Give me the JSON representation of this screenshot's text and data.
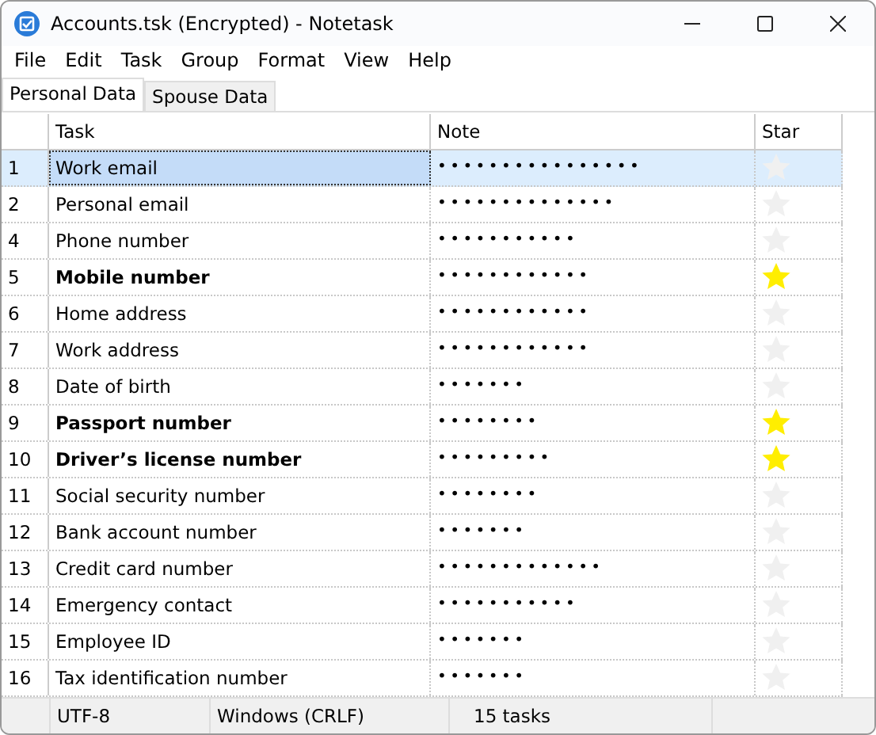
{
  "window": {
    "title": "Accounts.tsk (Encrypted) - Notetask"
  },
  "menu": [
    "File",
    "Edit",
    "Task",
    "Group",
    "Format",
    "View",
    "Help"
  ],
  "tabs": [
    {
      "label": "Personal Data",
      "selected": true
    },
    {
      "label": "Spouse Data",
      "selected": false
    }
  ],
  "table": {
    "columns": [
      "Task",
      "Note",
      "Star"
    ],
    "rows": [
      {
        "number": "1",
        "task": "Work email",
        "note": "••••••••••••••••",
        "starred": false,
        "selected": true
      },
      {
        "number": "2",
        "task": "Personal email",
        "note": "••••••••••••••",
        "starred": false,
        "selected": false
      },
      {
        "number": "4",
        "task": "Phone number",
        "note": "•••••••••••",
        "starred": false,
        "selected": false
      },
      {
        "number": "5",
        "task": "Mobile number",
        "note": "••••••••••••",
        "starred": true,
        "selected": false
      },
      {
        "number": "6",
        "task": "Home address",
        "note": "••••••••••••",
        "starred": false,
        "selected": false
      },
      {
        "number": "7",
        "task": "Work address",
        "note": "••••••••••••",
        "starred": false,
        "selected": false
      },
      {
        "number": "8",
        "task": "Date of birth",
        "note": "•••••••",
        "starred": false,
        "selected": false
      },
      {
        "number": "9",
        "task": "Passport number",
        "note": "••••••••",
        "starred": true,
        "selected": false
      },
      {
        "number": "10",
        "task": "Driver’s license number",
        "note": "•••••••••",
        "starred": true,
        "selected": false
      },
      {
        "number": "11",
        "task": "Social security number",
        "note": "••••••••",
        "starred": false,
        "selected": false
      },
      {
        "number": "12",
        "task": "Bank account number",
        "note": "•••••••",
        "starred": false,
        "selected": false
      },
      {
        "number": "13",
        "task": "Credit card number",
        "note": "•••••••••••••",
        "starred": false,
        "selected": false
      },
      {
        "number": "14",
        "task": "Emergency contact",
        "note": "•••••••••••",
        "starred": false,
        "selected": false
      },
      {
        "number": "15",
        "task": "Employee ID",
        "note": "•••••••",
        "starred": false,
        "selected": false
      },
      {
        "number": "16",
        "task": "Tax identification number",
        "note": "•••••••",
        "starred": false,
        "selected": false
      }
    ]
  },
  "status_bar": [
    "UTF-8",
    "Windows (CRLF)",
    "15 tasks"
  ]
}
